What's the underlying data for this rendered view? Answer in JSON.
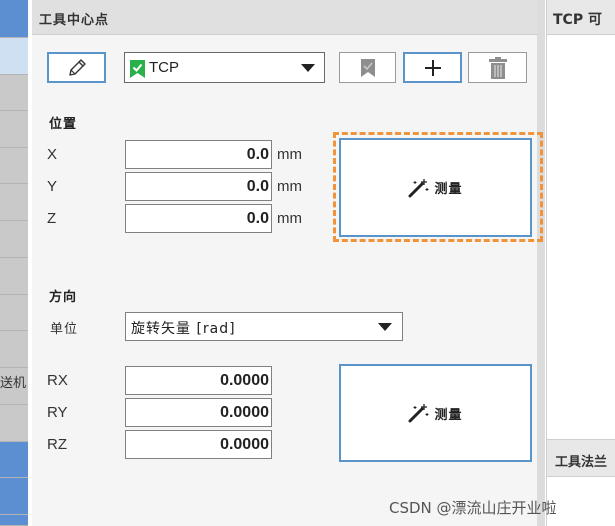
{
  "panel": {
    "title": "工具中心点"
  },
  "nav": {
    "partial_label": "送机"
  },
  "toolbar": {
    "tcp_select": {
      "value": "TCP"
    },
    "buttons": [
      "edit",
      "bookmark",
      "add",
      "delete"
    ]
  },
  "position": {
    "title": "位置",
    "rows": [
      {
        "axis": "X",
        "value": "0.0",
        "unit": "mm"
      },
      {
        "axis": "Y",
        "value": "0.0",
        "unit": "mm"
      },
      {
        "axis": "Z",
        "value": "0.0",
        "unit": "mm"
      }
    ],
    "measure_label": "测量"
  },
  "orientation": {
    "title": "方向",
    "unit_label": "单位",
    "unit_value": "旋转矢量 [rad]",
    "rows": [
      {
        "axis": "RX",
        "value": "0.0000"
      },
      {
        "axis": "RY",
        "value": "0.0000"
      },
      {
        "axis": "RZ",
        "value": "0.0000"
      }
    ],
    "measure_label": "测量"
  },
  "right_panel": {
    "title": "TCP 可",
    "second_title": "工具法兰"
  },
  "watermark": "CSDN @漂流山庄开业啦",
  "colors": {
    "accent_blue": "#5a94c8",
    "highlight_orange": "#f0943c",
    "flag_green": "#2bb14b",
    "nav_blue": "#5b8fd1"
  },
  "icons": [
    "pencil-icon",
    "flag-icon",
    "bookmark-icon",
    "plus-icon",
    "trash-icon",
    "magic-wand-icon",
    "chevron-down-icon"
  ]
}
